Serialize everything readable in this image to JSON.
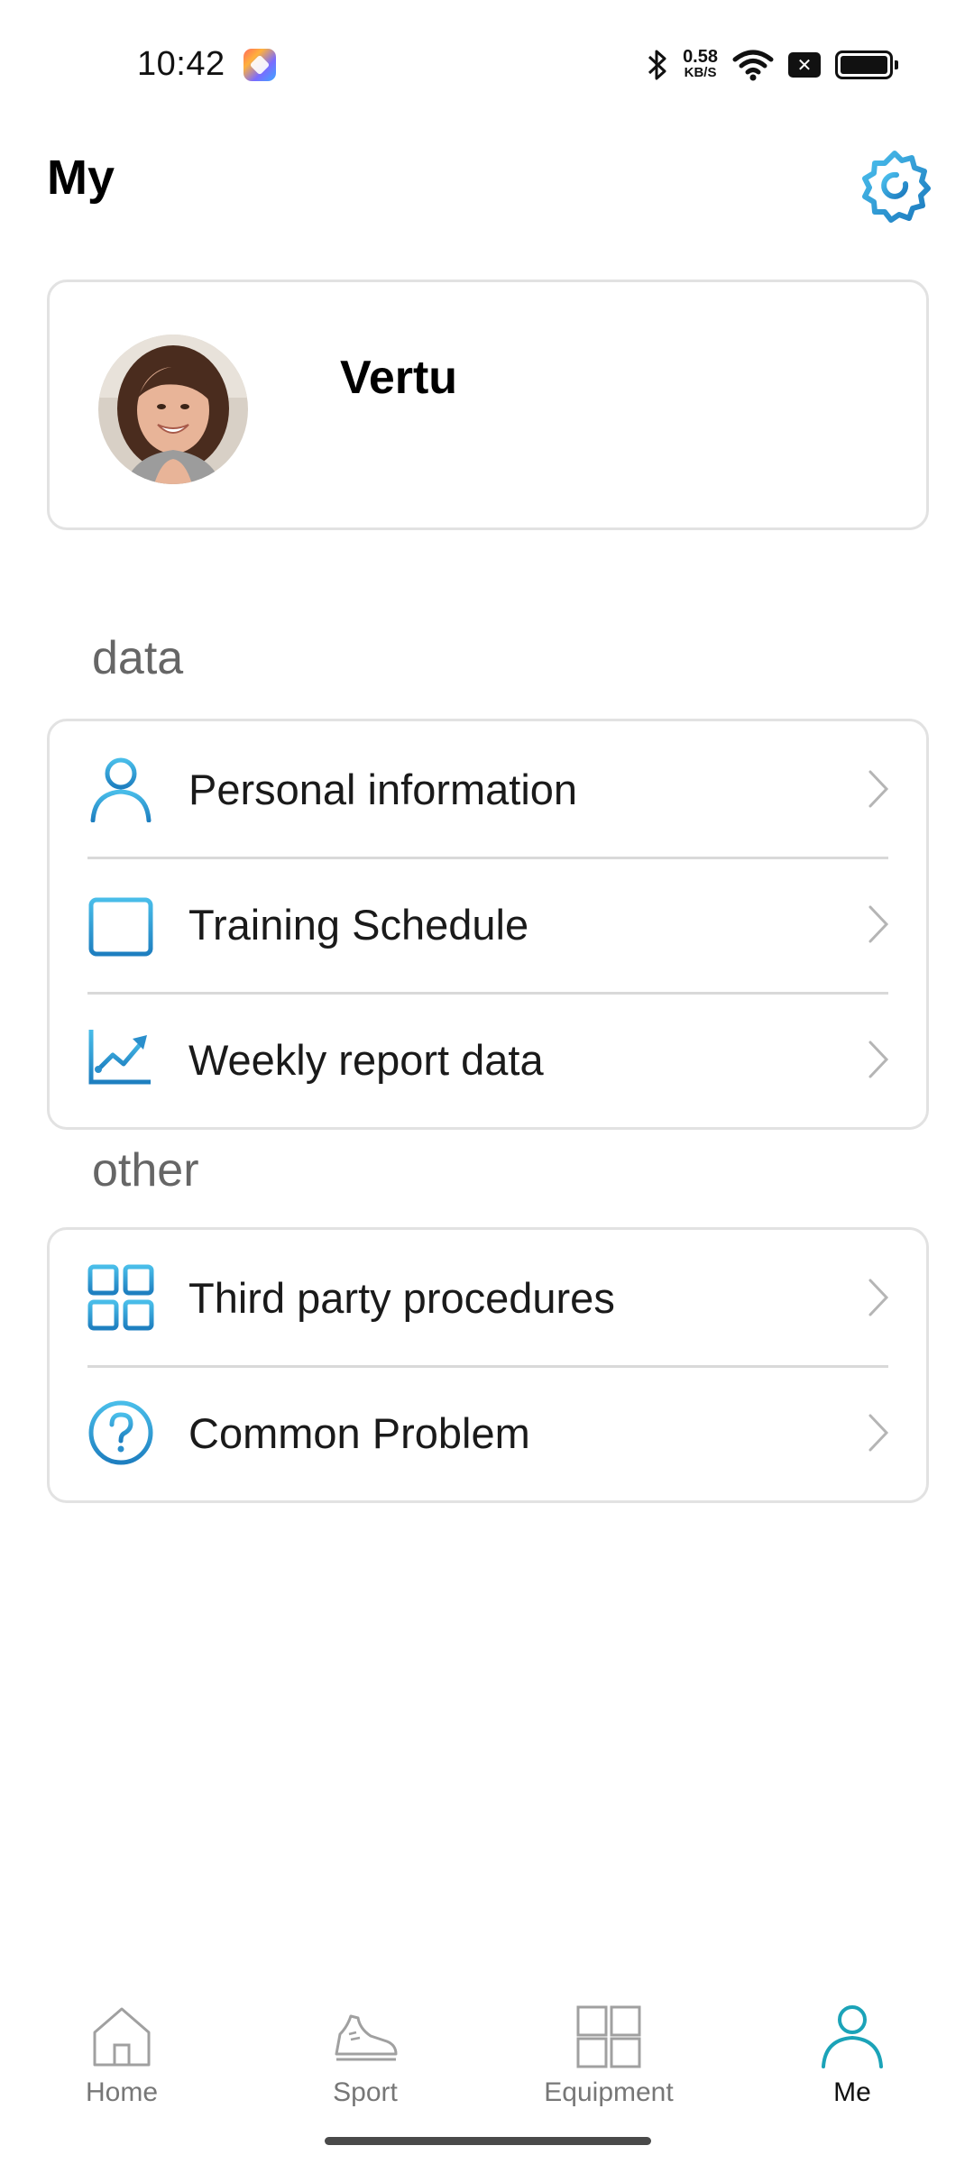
{
  "status_bar": {
    "time": "10:42",
    "net_speed_value": "0.58",
    "net_speed_unit": "KB/S",
    "x_glyph": "✕"
  },
  "header": {
    "title": "My"
  },
  "profile": {
    "name": "Vertu"
  },
  "sections": {
    "data_label": "data",
    "other_label": "other"
  },
  "data_menu": [
    {
      "label": "Personal information",
      "icon": "person-icon"
    },
    {
      "label": "Training Schedule",
      "icon": "calendar-icon"
    },
    {
      "label": "Weekly report data",
      "icon": "chart-trend-icon"
    }
  ],
  "other_menu": [
    {
      "label": "Third party procedures",
      "icon": "grid-icon"
    },
    {
      "label": "Common Problem",
      "icon": "question-icon"
    }
  ],
  "bottom_nav": [
    {
      "label": "Home",
      "icon": "home-icon",
      "active": false
    },
    {
      "label": "Sport",
      "icon": "shoe-icon",
      "active": false
    },
    {
      "label": "Equipment",
      "icon": "equipment-grid-icon",
      "active": false
    },
    {
      "label": "Me",
      "icon": "person-icon",
      "active": true
    }
  ],
  "colors": {
    "accent_gradient_start": "#3fb3e8",
    "accent_gradient_end": "#1e7fc0",
    "nav_active": "#1ba3b8",
    "nav_inactive": "#9a9a9a"
  }
}
